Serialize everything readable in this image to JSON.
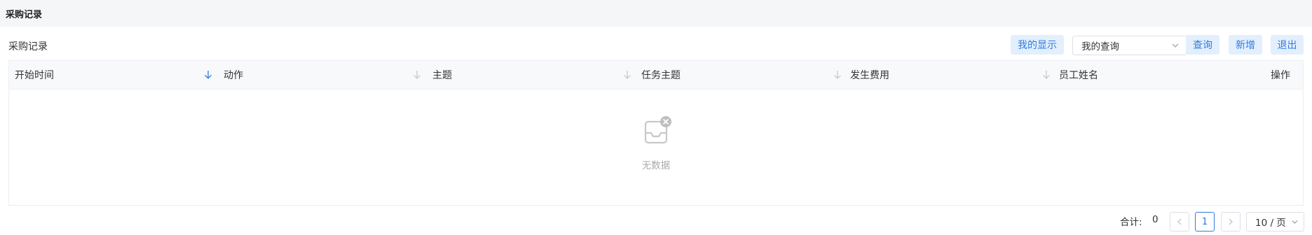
{
  "header": {
    "title": "采购记录"
  },
  "toolbar": {
    "section_title": "采购记录",
    "my_display_label": "我的显示",
    "query_select_value": "我的查询",
    "query_label": "查询",
    "add_label": "新增",
    "exit_label": "退出"
  },
  "table": {
    "columns": [
      {
        "label": "开始时间",
        "sorted": true
      },
      {
        "label": "动作",
        "sorted": false
      },
      {
        "label": "主题",
        "sorted": false
      },
      {
        "label": "任务主题",
        "sorted": false
      },
      {
        "label": "发生费用",
        "sorted": false
      },
      {
        "label": "员工姓名",
        "sorted": false
      }
    ],
    "action_column": "操作",
    "rows": [],
    "empty_text": "无数据"
  },
  "pagination": {
    "total_label": "合计:",
    "total": "0",
    "current_page": "1",
    "page_size": "10 / 页"
  },
  "colors": {
    "accent": "#2f7ce0",
    "button_bg": "#e3effd",
    "header_bg": "#f5f6f8"
  }
}
